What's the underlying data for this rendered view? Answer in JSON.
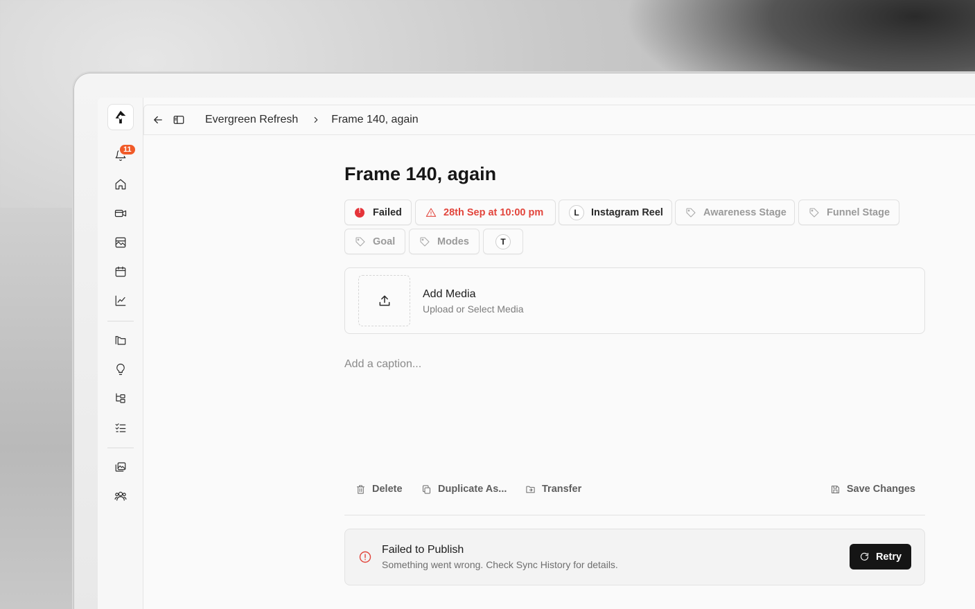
{
  "sidebar": {
    "notifications_count": "11",
    "items": [
      {
        "name": "bell-icon"
      },
      {
        "name": "home-icon"
      },
      {
        "name": "video-icon"
      },
      {
        "name": "image-icon"
      },
      {
        "name": "calendar-icon"
      },
      {
        "name": "chart-icon"
      },
      {
        "name": "folders-icon"
      },
      {
        "name": "lightbulb-icon"
      },
      {
        "name": "hierarchy-icon"
      },
      {
        "name": "checklist-icon"
      },
      {
        "name": "gallery-icon"
      },
      {
        "name": "users-icon"
      }
    ]
  },
  "breadcrumb": {
    "parent": "Evergreen Refresh",
    "current": "Frame 140, again"
  },
  "post": {
    "title": "Frame 140, again",
    "chips": {
      "status": "Failed",
      "date": "28th Sep at 10:00 pm",
      "channel_initial": "L",
      "channel": "Instagram Reel",
      "awareness": "Awareness Stage",
      "funnel": "Funnel Stage",
      "goal": "Goal",
      "modes": "Modes",
      "extra_initial": "T"
    },
    "media": {
      "title": "Add Media",
      "subtitle": "Upload or Select Media"
    },
    "caption_placeholder": "Add a caption..."
  },
  "actions": {
    "delete": "Delete",
    "duplicate": "Duplicate As...",
    "transfer": "Transfer",
    "save": "Save Changes"
  },
  "alert": {
    "title": "Failed to Publish",
    "message": "Something went wrong. Check Sync History for details.",
    "retry": "Retry"
  },
  "colors": {
    "accent_dark": "#151515",
    "error": "#e2453c",
    "badge": "#f05a28"
  }
}
